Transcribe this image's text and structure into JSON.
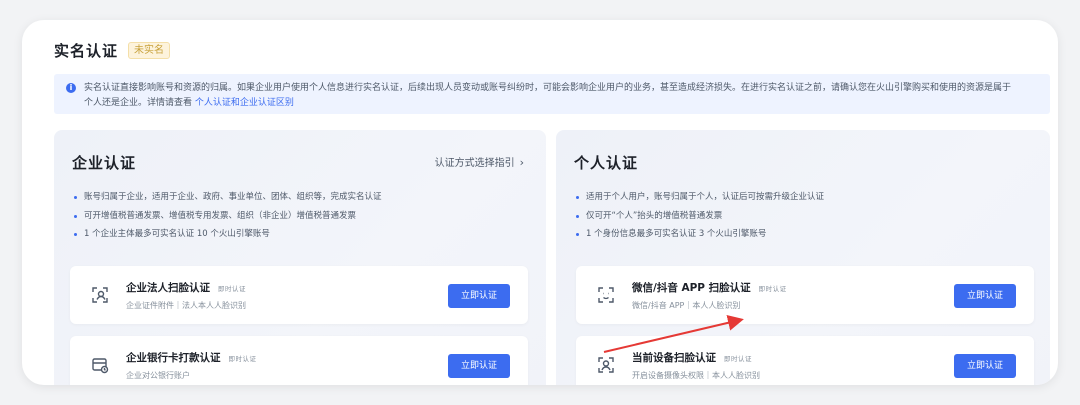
{
  "header": {
    "title": "实名认证",
    "status_badge": "未实名"
  },
  "notice": {
    "icon": "info-icon",
    "line1": "实名认证直接影响账号和资源的归属。如果企业用户使用个人信息进行实名认证，后续出现人员变动或账号纠纷时，可能会影响企业用户的业务，甚至造成经济损失。在进行实名认证之前，请确认您在火山引擎购买和使用的资源是属于",
    "line2": "个人还是企业。详情请查看",
    "link": "个人认证和企业认证区别"
  },
  "enterprise": {
    "title": "企业认证",
    "guide_link": "认证方式选择指引",
    "bullets": [
      "账号归属于企业，适用于企业、政府、事业单位、团体、组织等，完成实名认证",
      "可开增值税普通发票、增值税专用发票、组织（非企业）增值税普通发票",
      "1 个企业主体最多可实名认证 10 个火山引擎账号"
    ],
    "methods": [
      {
        "icon": "face-scan-icon",
        "title": "企业法人扫脸认证",
        "tag": "即时认证",
        "subtitle": "企业证件附件｜法人本人人脸识别",
        "button": "立即认证"
      },
      {
        "icon": "bank-card-icon",
        "title": "企业银行卡打款认证",
        "tag": "即时认证",
        "subtitle": "企业对公银行账户",
        "button": "立即认证"
      }
    ]
  },
  "personal": {
    "title": "个人认证",
    "bullets": [
      "适用于个人用户，账号归属于个人，认证后可按需升级企业认证",
      "仅可开“个人”抬头的增值税普通发票",
      "1 个身份信息最多可实名认证 3 个火山引擎账号"
    ],
    "methods": [
      {
        "icon": "app-scan-icon",
        "title": "微信/抖音 APP 扫脸认证",
        "tag": "即时认证",
        "subtitle": "微信/抖音 APP｜本人人脸识别",
        "button": "立即认证"
      },
      {
        "icon": "device-camera-icon",
        "title": "当前设备扫脸认证",
        "tag": "即时认证",
        "subtitle": "开启设备摄像头权限｜本人人脸识别",
        "button": "立即认证"
      }
    ]
  },
  "colors": {
    "accent": "#3c6cf0",
    "badge": "#c8a23c",
    "arrow": "#e53935"
  }
}
